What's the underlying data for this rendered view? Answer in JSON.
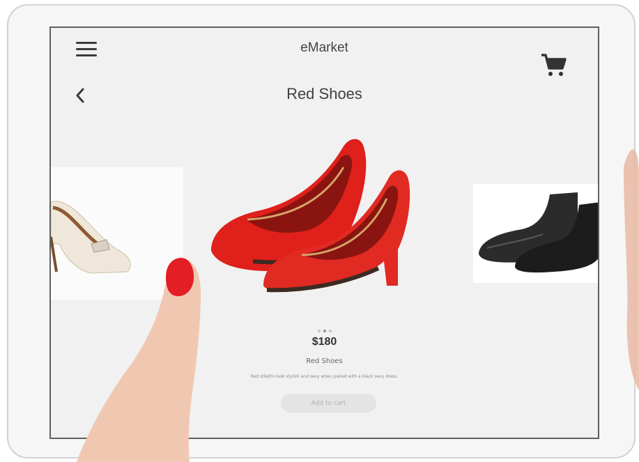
{
  "header": {
    "app_title": "eMarket"
  },
  "product": {
    "title": "Red Shoes",
    "price": "$180",
    "name": "Red Shoes",
    "description": "Red stiletto look stylish and sexy when paired with a black sexy dress.",
    "add_to_cart_label": "Add to cart"
  },
  "carousel": {
    "dots": 3,
    "active_dot": 1
  },
  "icons": {
    "menu": "hamburger-menu-icon",
    "cart": "shopping-cart-icon",
    "back": "chevron-left-icon"
  },
  "colors": {
    "accent_red": "#e0201b",
    "screen_bg": "#f1f1f1",
    "button_bg": "#e4e4e4"
  }
}
